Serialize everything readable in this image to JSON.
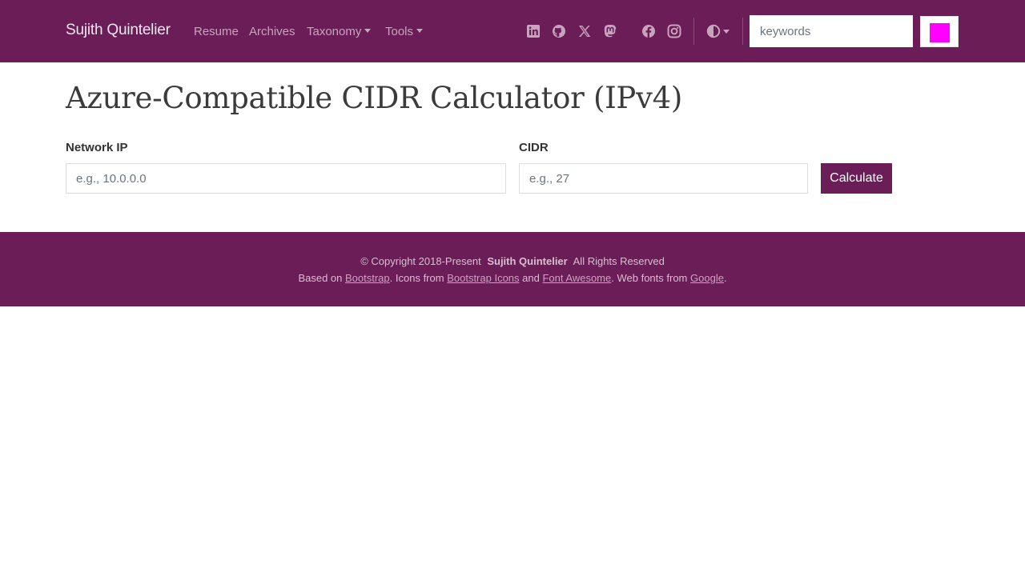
{
  "navbar": {
    "brand": "Sujith Quintelier",
    "links": [
      {
        "label": "Resume",
        "dropdown": false
      },
      {
        "label": "Archives",
        "dropdown": false
      },
      {
        "label": "Taxonomy",
        "dropdown": true
      },
      {
        "label": "Tools",
        "dropdown": true
      }
    ],
    "social_icons": [
      "linkedin-icon",
      "github-icon",
      "x-twitter-icon",
      "mastodon-icon",
      "facebook-icon",
      "instagram-icon"
    ],
    "theme_icon": "contrast-icon",
    "search": {
      "placeholder": "keywords",
      "value": ""
    },
    "search_button_color": "#ff00ff"
  },
  "main": {
    "title": "Azure-Compatible CIDR Calculator (IPv4)",
    "network_ip": {
      "label": "Network IP",
      "placeholder": "e.g., 10.0.0.0",
      "value": ""
    },
    "cidr": {
      "label": "CIDR",
      "placeholder": "e.g., 27",
      "value": ""
    },
    "calculate_label": "Calculate"
  },
  "footer": {
    "copyright_prefix": "© Copyright 2018-Present",
    "owner": "Sujith Quintelier",
    "rights": "All Rights Reserved",
    "based_on": "Based on",
    "bootstrap": "Bootstrap",
    "icons_from": ". Icons from",
    "bootstrap_icons": "Bootstrap Icons",
    "and": "and",
    "font_awesome": "Font Awesome",
    "web_fonts_from": ". Web fonts from",
    "google": "Google",
    "period": "."
  },
  "colors": {
    "brand": "#6a1d56",
    "nav_text": "#c8a4be",
    "accent_swatch": "#ff00ff"
  }
}
